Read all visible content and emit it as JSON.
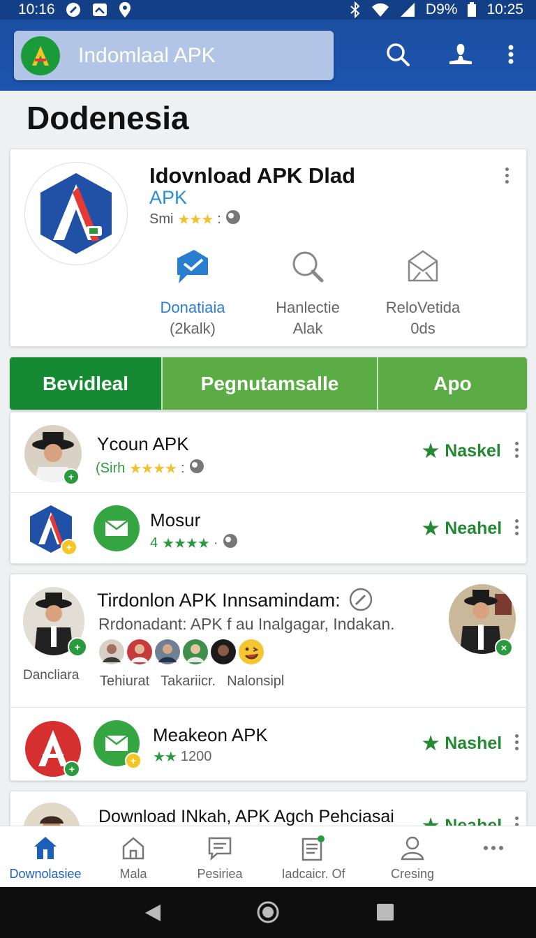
{
  "status_bar": {
    "time_left": "10:16",
    "battery": "D9%",
    "time_right": "10:25"
  },
  "app_bar": {
    "search_text": "Indomlaal APK"
  },
  "page_title": "Dodenesia",
  "hero": {
    "title": "Idovnload APK  Dlad",
    "subtitle": "APK",
    "rating_prefix": "Smi",
    "stars": "★★★",
    "actions": [
      {
        "label_line1": "Donatiaia",
        "label_line2": "(2kalk)",
        "icon": "message-icon"
      },
      {
        "label_line1": "Hanlectie",
        "label_line2": "Alak",
        "icon": "search-icon"
      },
      {
        "label_line1": "ReloVetida",
        "label_line2": "0ds",
        "icon": "mail-icon"
      }
    ]
  },
  "tabs": [
    "Bevidleal",
    "Pegnutamsalle",
    "Apo"
  ],
  "list1": [
    {
      "title": "Ycoun APK",
      "meta_prefix": "(Sirh",
      "stars": "★★★★",
      "action": "Naskel"
    },
    {
      "title": "Mosur",
      "meta_prefix": "4",
      "stars": "★★★★",
      "action": "Neahel"
    }
  ],
  "featured": {
    "title": "Tirdonlon APK Innsamindam:",
    "description": "Rrdonadant: APK f au  Inalgagar, Indakan.",
    "left_caption": "Dancliara",
    "tags": [
      "Tehiurat",
      "Takariicr.",
      "Nalonsipl"
    ]
  },
  "list2": [
    {
      "title": "Meakeon APK",
      "stars": "★★",
      "count": "1200",
      "action": "Nashel"
    },
    {
      "title": "Download INkah, APK Agch Pehciasai",
      "action": "Neahel"
    }
  ],
  "bottom_nav": [
    {
      "label": "Downolasiee",
      "icon": "home-icon",
      "active": true
    },
    {
      "label": "Mala",
      "icon": "house-outline-icon",
      "active": false
    },
    {
      "label": "Pesiriea",
      "icon": "chat-icon",
      "active": false
    },
    {
      "label": "Iadcaicr. Of",
      "icon": "document-icon",
      "active": false
    },
    {
      "label": "Cresing",
      "icon": "profile-icon",
      "active": false
    },
    {
      "label": "",
      "icon": "more-icon",
      "active": false
    }
  ],
  "colors": {
    "primary": "#1c55ae",
    "green": "#168a33",
    "light_green": "#5bac45",
    "accent_blue": "#2a7ed0"
  }
}
